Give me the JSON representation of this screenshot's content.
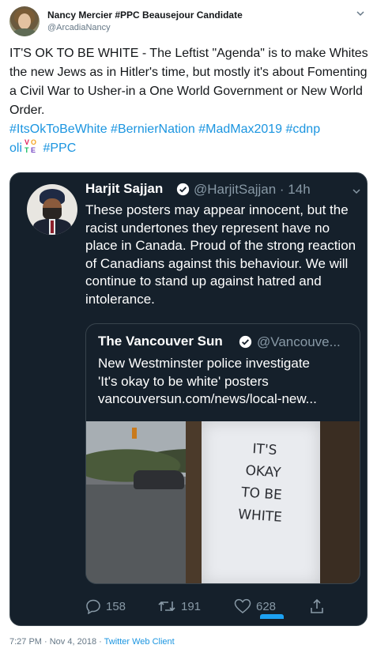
{
  "tweet": {
    "author": {
      "name": "Nancy Mercier #PPC Beausejour Candidate",
      "handle": "@ArcadiaNancy"
    },
    "text": "IT'S OK TO BE WHITE - The Leftist \"Agenda\" is to make Whites the new Jews as in Hitler's time, but mostly it's about Fomenting a Civil War to Usher-in a One World Government or New World Order.",
    "hashtags": {
      "part1": "#ItsOkToBeWhite #BernierNation #MadMax2019 #cdnp",
      "part2": "oli",
      "part3": "#PPC"
    },
    "vote_emoji": {
      "v": "V",
      "o": "O",
      "t": "T",
      "e": "E"
    },
    "timestamp": "7:27 PM · Nov 4, 2018 · ",
    "client": "Twitter Web Client"
  },
  "quoted_tweet": {
    "author_name": "Harjit Sajjan",
    "author_handle": "@HarjitSajjan · 14h",
    "text": "These posters may appear innocent, but the racist undertones they represent have no place in Canada. Proud of the strong reaction of Canadians against this behaviour. We will continue to stand up against hatred and intolerance.",
    "inner_card": {
      "name": "The Vancouver Sun",
      "handle": "@Vancouve...",
      "text_line1": "New Westminster police investigate",
      "text_line2": "'It's okay to be white' posters",
      "text_line3": "vancouversun.com/news/local-new...",
      "poster_lines": [
        "IT'S",
        "OKAY",
        "TO BE",
        "WHITE"
      ]
    },
    "actions": {
      "replies": "158",
      "retweets": "191",
      "likes": "628"
    }
  },
  "colors": {
    "link": "#1b95e0",
    "dark_bg": "#15202b",
    "muted": "#8899a6"
  }
}
